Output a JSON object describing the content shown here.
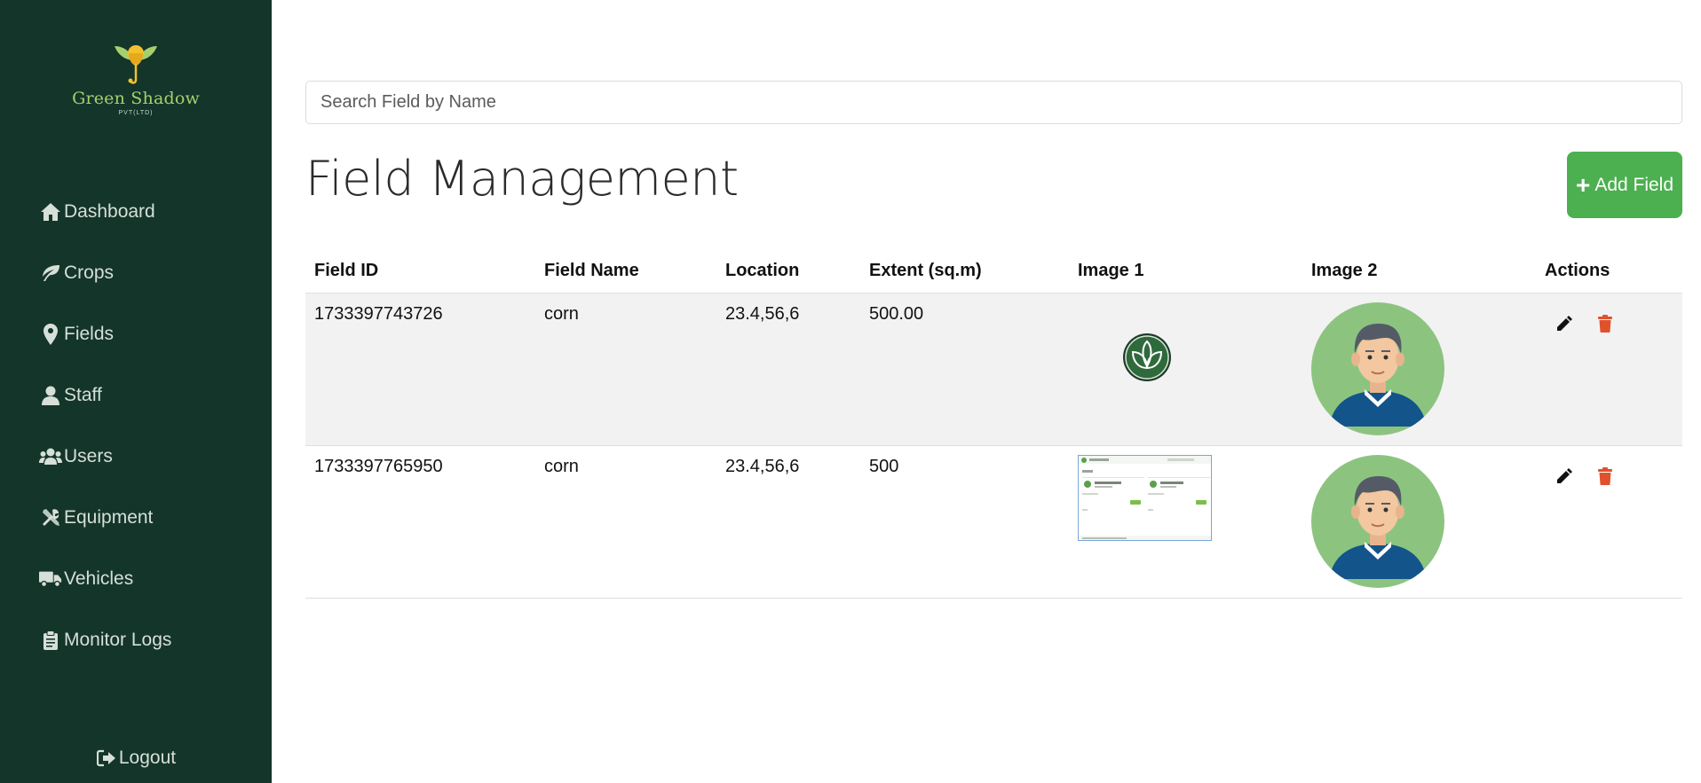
{
  "brand": {
    "name": "Green Shadow",
    "sub": "PVT(LTD)"
  },
  "sidebar": {
    "items": [
      {
        "label": "Dashboard",
        "icon": "home-icon"
      },
      {
        "label": "Crops",
        "icon": "leaf-icon"
      },
      {
        "label": "Fields",
        "icon": "map-marker-icon"
      },
      {
        "label": "Staff",
        "icon": "user-icon"
      },
      {
        "label": "Users",
        "icon": "users-icon"
      },
      {
        "label": "Equipment",
        "icon": "tools-icon"
      },
      {
        "label": "Vehicles",
        "icon": "truck-icon"
      },
      {
        "label": "Monitor Logs",
        "icon": "clipboard-icon"
      }
    ],
    "logout": "Logout"
  },
  "search": {
    "placeholder": "Search Field by Name",
    "value": ""
  },
  "page": {
    "title": "Field Management"
  },
  "add_button": {
    "label": "Add Field"
  },
  "table": {
    "headers": [
      "Field ID",
      "Field Name",
      "Location",
      "Extent (sq.m)",
      "Image 1",
      "Image 2",
      "Actions"
    ],
    "rows": [
      {
        "id": "1733397743726",
        "name": "corn",
        "location": "23.4,56,6",
        "extent": "500.00",
        "image1": "leaf-logo-image",
        "image2": "avatar-image"
      },
      {
        "id": "1733397765950",
        "name": "corn",
        "location": "23.4,56,6",
        "extent": "500",
        "image1": "screenshot-thumbnail-image",
        "image2": "avatar-image"
      }
    ]
  },
  "colors": {
    "sidebar": "#14352a",
    "accent": "#4caf50",
    "delete": "#e0522c",
    "logo": "#a7cf6e"
  }
}
